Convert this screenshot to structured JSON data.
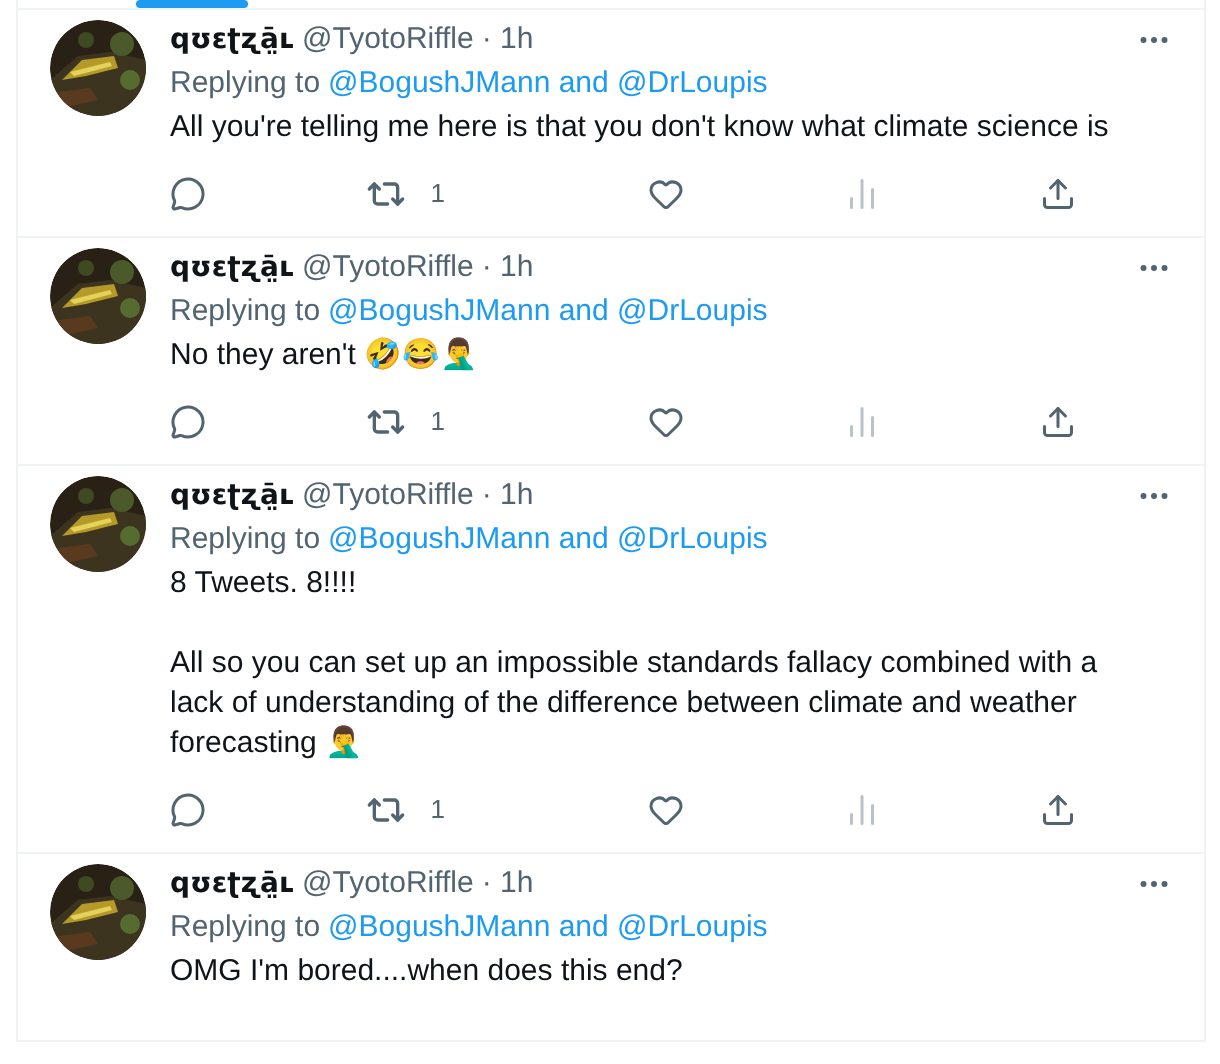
{
  "tabs": [
    {
      "selected": true
    }
  ],
  "tweets": [
    {
      "name": "qʊɛʈʐā̤ʟ",
      "handle": "@TyotoRiffle",
      "time": "· 1h",
      "replying_prefix": "Replying to",
      "replying_to": "@BogushJMann and @DrLoupis",
      "body": [
        "All you're telling me here is that you don't know what climate science is"
      ],
      "retweets": "1"
    },
    {
      "name": "qʊɛʈʐā̤ʟ",
      "handle": "@TyotoRiffle",
      "time": "· 1h",
      "replying_prefix": "Replying to",
      "replying_to": "@BogushJMann and @DrLoupis",
      "body": [
        "No they aren't 🤣😂🤦‍♂️"
      ],
      "retweets": "1"
    },
    {
      "name": "qʊɛʈʐā̤ʟ",
      "handle": "@TyotoRiffle",
      "time": "· 1h",
      "replying_prefix": "Replying to",
      "replying_to": "@BogushJMann and @DrLoupis",
      "body": [
        "8 Tweets. 8!!!!",
        "All so you can set up an impossible standards fallacy combined with a lack of understanding of the difference between climate and weather forecasting 🤦‍♂️"
      ],
      "retweets": "1"
    },
    {
      "name": "qʊɛʈʐā̤ʟ",
      "handle": "@TyotoRiffle",
      "time": "· 1h",
      "replying_prefix": "Replying to",
      "replying_to": "@BogushJMann and @DrLoupis",
      "body": [
        "OMG I'm bored....when does this end?"
      ]
    }
  ]
}
